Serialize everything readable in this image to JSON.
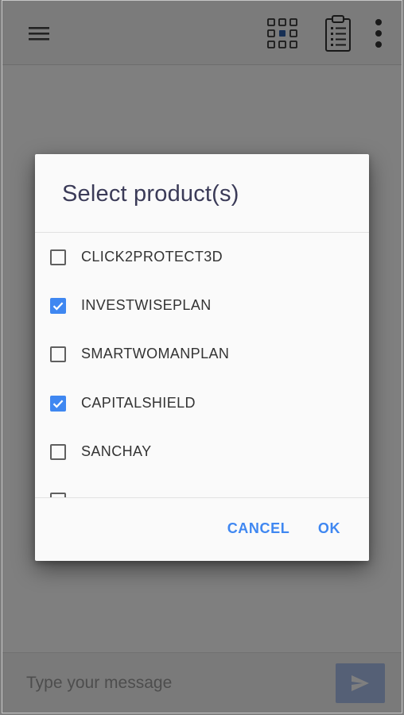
{
  "composer": {
    "placeholder": "Type your message"
  },
  "dialog": {
    "title": "Select product(s)",
    "products": [
      {
        "label": "CLICK2PROTECT3D",
        "checked": false
      },
      {
        "label": "INVESTWISEPLAN",
        "checked": true
      },
      {
        "label": "SMARTWOMANPLAN",
        "checked": false
      },
      {
        "label": "CAPITALSHIELD",
        "checked": true
      },
      {
        "label": "SANCHAY",
        "checked": false
      },
      {
        "label": "",
        "checked": false
      }
    ],
    "cancel_label": "CANCEL",
    "ok_label": "OK"
  },
  "colors": {
    "accent": "#3f87f1",
    "send_button": "#aac0ec",
    "title_text": "#3b3b58"
  },
  "icons": {
    "menu": "hamburger-menu-icon",
    "grid": "apps-grid-icon",
    "clipboard": "clipboard-list-icon",
    "more": "more-vert-icon",
    "send": "send-icon",
    "check": "check-icon"
  }
}
